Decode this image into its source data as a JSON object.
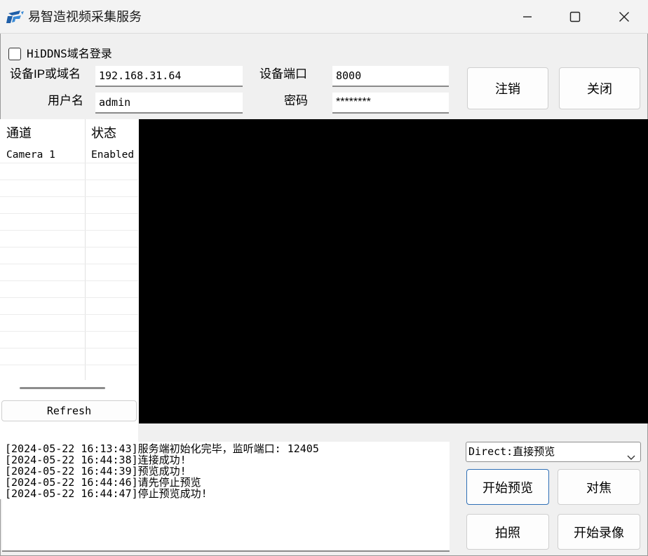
{
  "window": {
    "title": "易智造视频采集服务",
    "buttons": [
      "minimize-icon",
      "maximize-icon",
      "close-icon"
    ],
    "accent": "#2f6fb6"
  },
  "login": {
    "hiddns_label": "HiDDNS域名登录",
    "hiddns_checked": false,
    "ip_label": "设备IP或域名",
    "ip_value": "192.168.31.64",
    "port_label": "设备端口",
    "port_value": "8000",
    "user_label": "用户名",
    "user_value": "admin",
    "password_label": "密码",
    "password_value": "********",
    "logout_button": "注销",
    "close_button": "关闭"
  },
  "channels": {
    "columns": [
      "通道",
      "状态"
    ],
    "rows": [
      {
        "channel": "Camera 1",
        "status": "Enabled"
      }
    ],
    "refresh_button": "Refresh"
  },
  "log": {
    "lines": [
      "[2024-05-22 16:13:43]服务端初始化完毕，监听端口: 12405",
      "[2024-05-22 16:44:38]连接成功!",
      "[2024-05-22 16:44:39]预览成功!",
      "[2024-05-22 16:44:46]请先停止预览",
      "[2024-05-22 16:44:47]停止预览成功!"
    ]
  },
  "controls": {
    "mode_selected": "Direct:直接预览",
    "start_preview": "开始预览",
    "focus": "对焦",
    "snapshot": "拍照",
    "start_record": "开始录像"
  }
}
